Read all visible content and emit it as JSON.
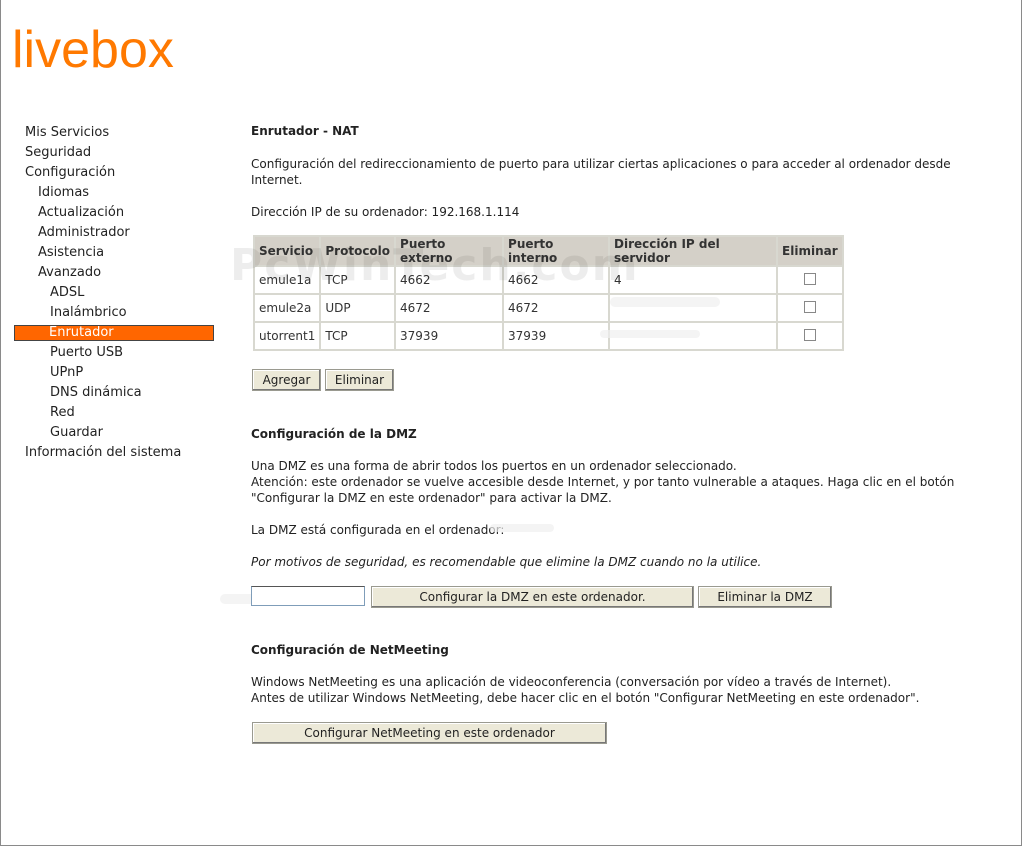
{
  "brand": {
    "logo": "livebox",
    "color": "#ff7900"
  },
  "sidebar": {
    "items": [
      {
        "label": "Mis Servicios"
      },
      {
        "label": "Seguridad"
      },
      {
        "label": "Configuración"
      },
      {
        "label": "Idiomas"
      },
      {
        "label": "Actualización"
      },
      {
        "label": "Administrador"
      },
      {
        "label": "Asistencia"
      },
      {
        "label": "Avanzado"
      },
      {
        "label": "ADSL"
      },
      {
        "label": "Inalámbrico"
      },
      {
        "label": "Enrutador",
        "active": true
      },
      {
        "label": "Puerto USB"
      },
      {
        "label": "UPnP"
      },
      {
        "label": "DNS dinámica"
      },
      {
        "label": "Red"
      },
      {
        "label": "Guardar"
      },
      {
        "label": "Información del sistema"
      }
    ],
    "active_color": "#ff6600"
  },
  "nat": {
    "title": "Enrutador - NAT",
    "desc_line1": "Configuración del redireccionamiento de puerto para utilizar ciertas aplicaciones o para acceder al ordenador desde",
    "desc_line2": "Internet.",
    "ip_line": "Dirección IP de su ordenador: 192.168.1.114",
    "columns": [
      "Servicio",
      "Protocolo",
      "Puerto externo",
      "Puerto interno",
      "Dirección IP del servidor",
      "Eliminar"
    ],
    "rows": [
      {
        "servicio": "emule1a",
        "protocolo": "TCP",
        "externo": "4662",
        "interno": "4662",
        "ip": "4"
      },
      {
        "servicio": "emule2a",
        "protocolo": "UDP",
        "externo": "4672",
        "interno": "4672",
        "ip": ""
      },
      {
        "servicio": "utorrent1",
        "protocolo": "TCP",
        "externo": "37939",
        "interno": "37939",
        "ip": ""
      }
    ],
    "add_button": "Agregar",
    "delete_button": "Eliminar"
  },
  "dmz": {
    "title": "Configuración de la DMZ",
    "line1": "Una DMZ es una forma de abrir todos los puertos en un ordenador seleccionado.",
    "line2": "Atención: este ordenador se vuelve accesible desde Internet, y por tanto vulnerable a ataques. Haga clic en el botón",
    "line3": "\"Configurar la DMZ en este ordenador\" para activar la DMZ.",
    "configured": "La DMZ está configurada en el ordenador:",
    "warning": "Por motivos de seguridad, es recomendable que elimine la DMZ cuando no la utilice.",
    "input_value": "",
    "configure_button": "Configurar la DMZ en este ordenador.",
    "delete_button": "Eliminar la DMZ"
  },
  "netmeeting": {
    "title": "Configuración de NetMeeting",
    "line1": "Windows NetMeeting es una aplicación de videoconferencia (conversación por vídeo a través de Internet).",
    "line2": "Antes de utilizar Windows NetMeeting, debe hacer clic en el botón \"Configurar NetMeeting en este ordenador\".",
    "button": "Configurar NetMeeting en este ordenador"
  },
  "watermark": "PcWinTech.com"
}
